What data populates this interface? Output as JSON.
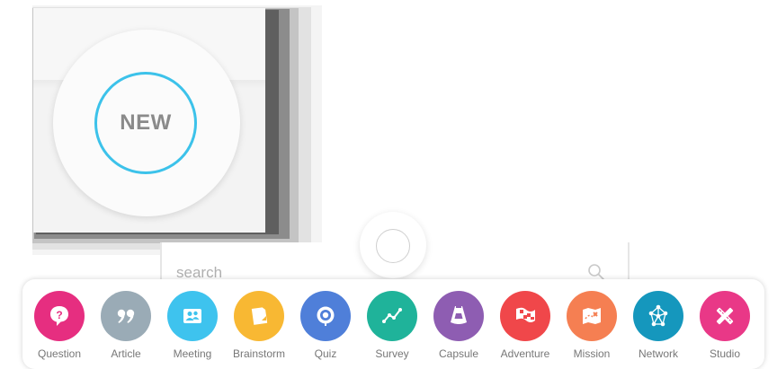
{
  "new_badge": {
    "label": "NEW",
    "ring_color": "#3cc2ea"
  },
  "search": {
    "placeholder": "search"
  },
  "apps": [
    {
      "label": "Question",
      "icon": "question-icon",
      "color": "#e62e80"
    },
    {
      "label": "Article",
      "icon": "quote-icon",
      "color": "#9aabb6"
    },
    {
      "label": "Meeting",
      "icon": "people-icon",
      "color": "#3ec3ee"
    },
    {
      "label": "Brainstorm",
      "icon": "sticky-note-icon",
      "color": "#f8b833"
    },
    {
      "label": "Quiz",
      "icon": "target-icon",
      "color": "#4f7fd9"
    },
    {
      "label": "Survey",
      "icon": "line-graph-icon",
      "color": "#1fb39a"
    },
    {
      "label": "Capsule",
      "icon": "capsule-icon",
      "color": "#8e5db2"
    },
    {
      "label": "Adventure",
      "icon": "flag-icon",
      "color": "#f0474a"
    },
    {
      "label": "Mission",
      "icon": "map-icon",
      "color": "#f57f52"
    },
    {
      "label": "Network",
      "icon": "network-icon",
      "color": "#1597bd"
    },
    {
      "label": "Studio",
      "icon": "pencil-ruler-icon",
      "color": "#e93887"
    }
  ]
}
